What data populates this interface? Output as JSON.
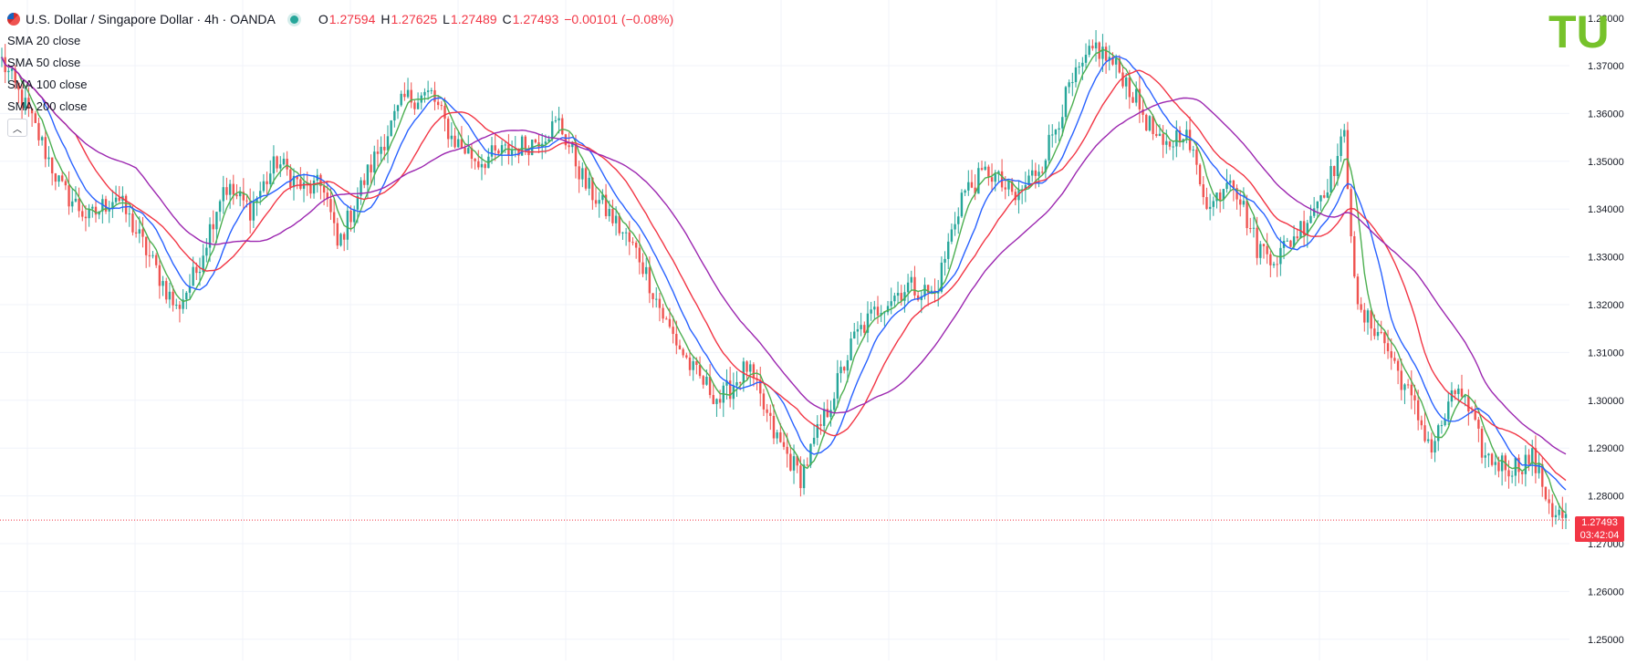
{
  "header": {
    "title": "U.S. Dollar / Singapore Dollar · 4h · OANDA",
    "ohlc": [
      {
        "key": "O",
        "value": "1.27594"
      },
      {
        "key": "H",
        "value": "1.27625"
      },
      {
        "key": "L",
        "value": "1.27489"
      },
      {
        "key": "C",
        "value": "1.27493"
      }
    ],
    "change": "−0.00101 (−0.08%)"
  },
  "indicators": [
    {
      "label": "SMA",
      "value": "20 close",
      "color": "#4caf50"
    },
    {
      "label": "SMA",
      "value": "50 close",
      "color": "#2962ff"
    },
    {
      "label": "SMA",
      "value": "100 close",
      "color": "#f23645"
    },
    {
      "label": "SMA",
      "value": "200 close",
      "color": "#9c27b0"
    }
  ],
  "collapse_icon": "chevron-up-icon",
  "logo_text": "TU",
  "colors": {
    "up": "#26a69a",
    "down": "#ef5350",
    "accent": "#f23645",
    "logo": "#76c22b",
    "grid": "#f0f3fa"
  },
  "price_tag": {
    "price": "1.27493",
    "countdown": "03:42:04"
  },
  "chart_data": {
    "type": "candlestick",
    "yaxis_ticks": [
      "1.28000",
      "1.37000",
      "1.36000",
      "1.35000",
      "1.34000",
      "1.33000",
      "1.32000",
      "1.31000",
      "1.30000",
      "1.29000",
      "1.28000",
      "1.27000",
      "1.26000",
      "1.25000"
    ],
    "ylim": [
      1.25,
      1.38
    ],
    "grid": true,
    "last_price": 1.27493,
    "close_path": [
      [
        0,
        1.371
      ],
      [
        8,
        1.36
      ],
      [
        18,
        1.344
      ],
      [
        26,
        1.338
      ],
      [
        34,
        1.343
      ],
      [
        44,
        1.33
      ],
      [
        52,
        1.319
      ],
      [
        58,
        1.327
      ],
      [
        66,
        1.345
      ],
      [
        74,
        1.34
      ],
      [
        82,
        1.35
      ],
      [
        90,
        1.344
      ],
      [
        96,
        1.345
      ],
      [
        100,
        1.332
      ],
      [
        106,
        1.343
      ],
      [
        112,
        1.352
      ],
      [
        120,
        1.363
      ],
      [
        128,
        1.364
      ],
      [
        134,
        1.355
      ],
      [
        142,
        1.35
      ],
      [
        150,
        1.352
      ],
      [
        158,
        1.354
      ],
      [
        166,
        1.358
      ],
      [
        174,
        1.345
      ],
      [
        182,
        1.338
      ],
      [
        190,
        1.33
      ],
      [
        198,
        1.316
      ],
      [
        206,
        1.306
      ],
      [
        214,
        1.3
      ],
      [
        222,
        1.307
      ],
      [
        230,
        1.293
      ],
      [
        238,
        1.284
      ],
      [
        246,
        1.298
      ],
      [
        254,
        1.313
      ],
      [
        262,
        1.32
      ],
      [
        270,
        1.324
      ],
      [
        278,
        1.322
      ],
      [
        286,
        1.343
      ],
      [
        294,
        1.348
      ],
      [
        302,
        1.342
      ],
      [
        310,
        1.35
      ],
      [
        318,
        1.365
      ],
      [
        326,
        1.374
      ],
      [
        334,
        1.368
      ],
      [
        340,
        1.36
      ],
      [
        346,
        1.352
      ],
      [
        352,
        1.357
      ],
      [
        360,
        1.34
      ],
      [
        366,
        1.348
      ],
      [
        374,
        1.332
      ],
      [
        380,
        1.33
      ],
      [
        388,
        1.337
      ],
      [
        396,
        1.347
      ],
      [
        400,
        1.355
      ],
      [
        404,
        1.318
      ],
      [
        410,
        1.315
      ],
      [
        418,
        1.303
      ],
      [
        426,
        1.29
      ],
      [
        434,
        1.303
      ],
      [
        442,
        1.288
      ],
      [
        450,
        1.286
      ],
      [
        456,
        1.288
      ],
      [
        462,
        1.277
      ],
      [
        466,
        1.275
      ]
    ],
    "sma": [
      {
        "name": "SMA 20 close",
        "color": "#4caf50"
      },
      {
        "name": "SMA 50 close",
        "color": "#2962ff"
      },
      {
        "name": "SMA 100 close",
        "color": "#f23645"
      },
      {
        "name": "SMA 200 close",
        "color": "#9c27b0"
      }
    ]
  }
}
